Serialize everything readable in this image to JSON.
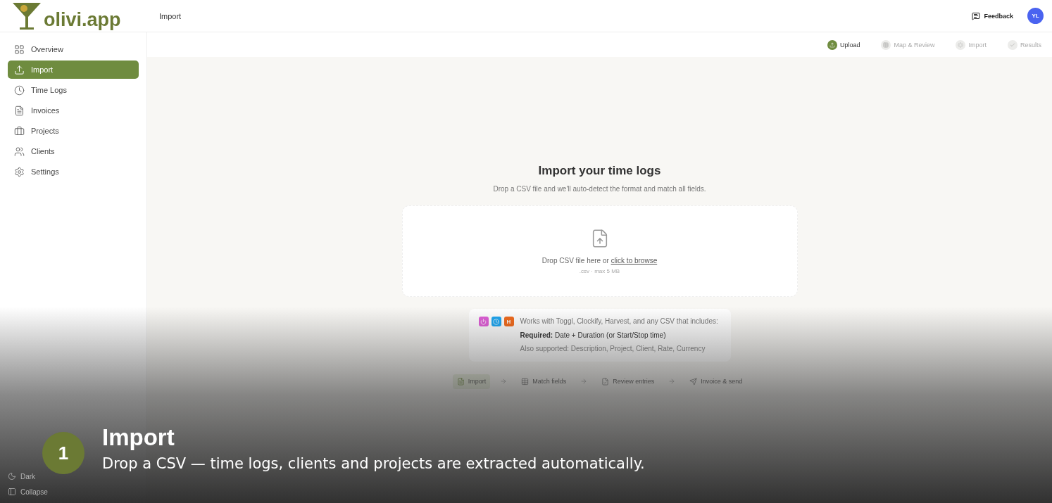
{
  "header": {
    "logo": "olivi.app",
    "page_title": "Import",
    "feedback": "Feedback",
    "avatar": "YL"
  },
  "sidebar": {
    "items": [
      {
        "label": "Overview",
        "selected": false
      },
      {
        "label": "Import",
        "selected": true
      },
      {
        "label": "Time Logs",
        "selected": false
      },
      {
        "label": "Invoices",
        "selected": false
      },
      {
        "label": "Projects",
        "selected": false
      },
      {
        "label": "Clients",
        "selected": false
      },
      {
        "label": "Settings",
        "selected": false
      }
    ],
    "footer": [
      {
        "label": "Dark"
      },
      {
        "label": "Collapse"
      }
    ]
  },
  "stepper": [
    {
      "label": "Upload",
      "selected": true
    },
    {
      "label": "Map & Review",
      "selected": false
    },
    {
      "label": "Import",
      "selected": false
    },
    {
      "label": "Results",
      "selected": false
    }
  ],
  "main": {
    "title": "Import your time logs",
    "subtitle": "Drop a CSV file and we'll auto-detect the format and match all fields.",
    "dropzone": {
      "text": "Drop CSV file here or",
      "link": "click to browse",
      "hint": ".csv · max 5 MB"
    },
    "info": {
      "badges": [
        {
          "kind": "power",
          "color": "#e05fd8"
        },
        {
          "kind": "clock",
          "color": "#1ea7f2"
        },
        {
          "kind": "letter",
          "label": "H",
          "color": "#f26b1d"
        }
      ],
      "text": "Works with Toggl, Clockify, Harvest, and any CSV that includes:",
      "required": "**Required:** Date + Duration (or Start/Stop time)",
      "supported": "Also supported: Description, Project, Client, Rate, Currency"
    },
    "flow": [
      {
        "label": "Import",
        "selected": true
      },
      {
        "label": "Match fields",
        "selected": false
      },
      {
        "label": "Review entries",
        "selected": false
      },
      {
        "label": "Invoice & send",
        "selected": false
      }
    ]
  },
  "caption": {
    "number": "1",
    "title": "Import",
    "text": "Drop a CSV — time logs, clients and projects are extracted automatically."
  }
}
